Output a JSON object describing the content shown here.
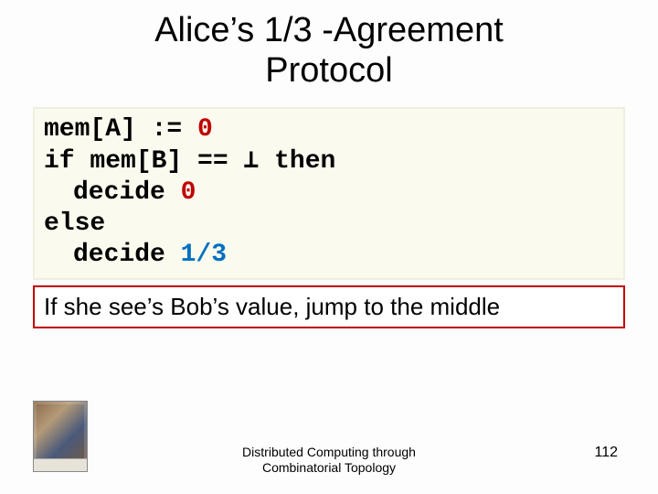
{
  "title_line1": "Alice’s 1/3 -Agreement",
  "title_line2": "Protocol",
  "code": {
    "l1_pre": "mem[A] := ",
    "l1_val": "0",
    "l2": "if mem[B] == ⊥ then",
    "l3_pre": "decide ",
    "l3_val": "0",
    "l4": "else",
    "l5_pre": "decide ",
    "l5_val": "1/3"
  },
  "caption": "If she see’s Bob’s value, jump to the middle",
  "footer_line1": "Distributed Computing through",
  "footer_line2": "Combinatorial Topology",
  "page_number": "112"
}
